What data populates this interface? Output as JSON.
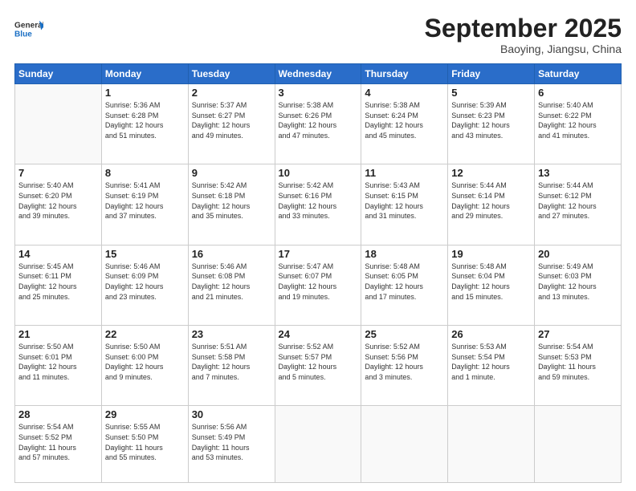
{
  "header": {
    "logo_line1": "General",
    "logo_line2": "Blue",
    "month_title": "September 2025",
    "location": "Baoying, Jiangsu, China"
  },
  "weekdays": [
    "Sunday",
    "Monday",
    "Tuesday",
    "Wednesday",
    "Thursday",
    "Friday",
    "Saturday"
  ],
  "weeks": [
    [
      {
        "day": "",
        "info": ""
      },
      {
        "day": "1",
        "info": "Sunrise: 5:36 AM\nSunset: 6:28 PM\nDaylight: 12 hours\nand 51 minutes."
      },
      {
        "day": "2",
        "info": "Sunrise: 5:37 AM\nSunset: 6:27 PM\nDaylight: 12 hours\nand 49 minutes."
      },
      {
        "day": "3",
        "info": "Sunrise: 5:38 AM\nSunset: 6:26 PM\nDaylight: 12 hours\nand 47 minutes."
      },
      {
        "day": "4",
        "info": "Sunrise: 5:38 AM\nSunset: 6:24 PM\nDaylight: 12 hours\nand 45 minutes."
      },
      {
        "day": "5",
        "info": "Sunrise: 5:39 AM\nSunset: 6:23 PM\nDaylight: 12 hours\nand 43 minutes."
      },
      {
        "day": "6",
        "info": "Sunrise: 5:40 AM\nSunset: 6:22 PM\nDaylight: 12 hours\nand 41 minutes."
      }
    ],
    [
      {
        "day": "7",
        "info": "Sunrise: 5:40 AM\nSunset: 6:20 PM\nDaylight: 12 hours\nand 39 minutes."
      },
      {
        "day": "8",
        "info": "Sunrise: 5:41 AM\nSunset: 6:19 PM\nDaylight: 12 hours\nand 37 minutes."
      },
      {
        "day": "9",
        "info": "Sunrise: 5:42 AM\nSunset: 6:18 PM\nDaylight: 12 hours\nand 35 minutes."
      },
      {
        "day": "10",
        "info": "Sunrise: 5:42 AM\nSunset: 6:16 PM\nDaylight: 12 hours\nand 33 minutes."
      },
      {
        "day": "11",
        "info": "Sunrise: 5:43 AM\nSunset: 6:15 PM\nDaylight: 12 hours\nand 31 minutes."
      },
      {
        "day": "12",
        "info": "Sunrise: 5:44 AM\nSunset: 6:14 PM\nDaylight: 12 hours\nand 29 minutes."
      },
      {
        "day": "13",
        "info": "Sunrise: 5:44 AM\nSunset: 6:12 PM\nDaylight: 12 hours\nand 27 minutes."
      }
    ],
    [
      {
        "day": "14",
        "info": "Sunrise: 5:45 AM\nSunset: 6:11 PM\nDaylight: 12 hours\nand 25 minutes."
      },
      {
        "day": "15",
        "info": "Sunrise: 5:46 AM\nSunset: 6:09 PM\nDaylight: 12 hours\nand 23 minutes."
      },
      {
        "day": "16",
        "info": "Sunrise: 5:46 AM\nSunset: 6:08 PM\nDaylight: 12 hours\nand 21 minutes."
      },
      {
        "day": "17",
        "info": "Sunrise: 5:47 AM\nSunset: 6:07 PM\nDaylight: 12 hours\nand 19 minutes."
      },
      {
        "day": "18",
        "info": "Sunrise: 5:48 AM\nSunset: 6:05 PM\nDaylight: 12 hours\nand 17 minutes."
      },
      {
        "day": "19",
        "info": "Sunrise: 5:48 AM\nSunset: 6:04 PM\nDaylight: 12 hours\nand 15 minutes."
      },
      {
        "day": "20",
        "info": "Sunrise: 5:49 AM\nSunset: 6:03 PM\nDaylight: 12 hours\nand 13 minutes."
      }
    ],
    [
      {
        "day": "21",
        "info": "Sunrise: 5:50 AM\nSunset: 6:01 PM\nDaylight: 12 hours\nand 11 minutes."
      },
      {
        "day": "22",
        "info": "Sunrise: 5:50 AM\nSunset: 6:00 PM\nDaylight: 12 hours\nand 9 minutes."
      },
      {
        "day": "23",
        "info": "Sunrise: 5:51 AM\nSunset: 5:58 PM\nDaylight: 12 hours\nand 7 minutes."
      },
      {
        "day": "24",
        "info": "Sunrise: 5:52 AM\nSunset: 5:57 PM\nDaylight: 12 hours\nand 5 minutes."
      },
      {
        "day": "25",
        "info": "Sunrise: 5:52 AM\nSunset: 5:56 PM\nDaylight: 12 hours\nand 3 minutes."
      },
      {
        "day": "26",
        "info": "Sunrise: 5:53 AM\nSunset: 5:54 PM\nDaylight: 12 hours\nand 1 minute."
      },
      {
        "day": "27",
        "info": "Sunrise: 5:54 AM\nSunset: 5:53 PM\nDaylight: 11 hours\nand 59 minutes."
      }
    ],
    [
      {
        "day": "28",
        "info": "Sunrise: 5:54 AM\nSunset: 5:52 PM\nDaylight: 11 hours\nand 57 minutes."
      },
      {
        "day": "29",
        "info": "Sunrise: 5:55 AM\nSunset: 5:50 PM\nDaylight: 11 hours\nand 55 minutes."
      },
      {
        "day": "30",
        "info": "Sunrise: 5:56 AM\nSunset: 5:49 PM\nDaylight: 11 hours\nand 53 minutes."
      },
      {
        "day": "",
        "info": ""
      },
      {
        "day": "",
        "info": ""
      },
      {
        "day": "",
        "info": ""
      },
      {
        "day": "",
        "info": ""
      }
    ]
  ]
}
